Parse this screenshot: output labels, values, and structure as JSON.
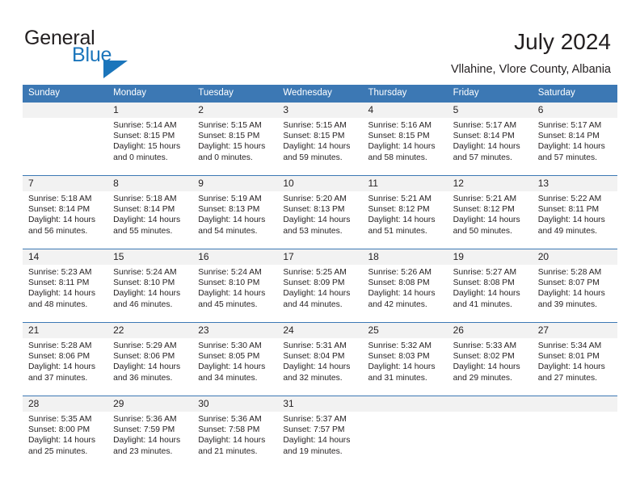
{
  "brand": {
    "name_part1": "General",
    "name_part2": "Blue",
    "accent_color": "#1b75bb"
  },
  "header": {
    "title": "July 2024",
    "subtitle": "Vllahine, Vlore County, Albania",
    "header_color": "#3c78b4",
    "daynum_row_color": "#f2f2f2"
  },
  "weekdays": [
    "Sunday",
    "Monday",
    "Tuesday",
    "Wednesday",
    "Thursday",
    "Friday",
    "Saturday"
  ],
  "labels": {
    "sunrise_prefix": "Sunrise:",
    "sunset_prefix": "Sunset:",
    "daylight_prefix": "Daylight:"
  },
  "weeks": [
    [
      {
        "day": "",
        "sunrise": "",
        "sunset": "",
        "daylight_l1": "",
        "daylight_l2": "",
        "empty": true
      },
      {
        "day": "1",
        "sunrise": "Sunrise: 5:14 AM",
        "sunset": "Sunset: 8:15 PM",
        "daylight_l1": "Daylight: 15 hours",
        "daylight_l2": "and 0 minutes.",
        "empty": false
      },
      {
        "day": "2",
        "sunrise": "Sunrise: 5:15 AM",
        "sunset": "Sunset: 8:15 PM",
        "daylight_l1": "Daylight: 15 hours",
        "daylight_l2": "and 0 minutes.",
        "empty": false
      },
      {
        "day": "3",
        "sunrise": "Sunrise: 5:15 AM",
        "sunset": "Sunset: 8:15 PM",
        "daylight_l1": "Daylight: 14 hours",
        "daylight_l2": "and 59 minutes.",
        "empty": false
      },
      {
        "day": "4",
        "sunrise": "Sunrise: 5:16 AM",
        "sunset": "Sunset: 8:15 PM",
        "daylight_l1": "Daylight: 14 hours",
        "daylight_l2": "and 58 minutes.",
        "empty": false
      },
      {
        "day": "5",
        "sunrise": "Sunrise: 5:17 AM",
        "sunset": "Sunset: 8:14 PM",
        "daylight_l1": "Daylight: 14 hours",
        "daylight_l2": "and 57 minutes.",
        "empty": false
      },
      {
        "day": "6",
        "sunrise": "Sunrise: 5:17 AM",
        "sunset": "Sunset: 8:14 PM",
        "daylight_l1": "Daylight: 14 hours",
        "daylight_l2": "and 57 minutes.",
        "empty": false
      }
    ],
    [
      {
        "day": "7",
        "sunrise": "Sunrise: 5:18 AM",
        "sunset": "Sunset: 8:14 PM",
        "daylight_l1": "Daylight: 14 hours",
        "daylight_l2": "and 56 minutes.",
        "empty": false
      },
      {
        "day": "8",
        "sunrise": "Sunrise: 5:18 AM",
        "sunset": "Sunset: 8:14 PM",
        "daylight_l1": "Daylight: 14 hours",
        "daylight_l2": "and 55 minutes.",
        "empty": false
      },
      {
        "day": "9",
        "sunrise": "Sunrise: 5:19 AM",
        "sunset": "Sunset: 8:13 PM",
        "daylight_l1": "Daylight: 14 hours",
        "daylight_l2": "and 54 minutes.",
        "empty": false
      },
      {
        "day": "10",
        "sunrise": "Sunrise: 5:20 AM",
        "sunset": "Sunset: 8:13 PM",
        "daylight_l1": "Daylight: 14 hours",
        "daylight_l2": "and 53 minutes.",
        "empty": false
      },
      {
        "day": "11",
        "sunrise": "Sunrise: 5:21 AM",
        "sunset": "Sunset: 8:12 PM",
        "daylight_l1": "Daylight: 14 hours",
        "daylight_l2": "and 51 minutes.",
        "empty": false
      },
      {
        "day": "12",
        "sunrise": "Sunrise: 5:21 AM",
        "sunset": "Sunset: 8:12 PM",
        "daylight_l1": "Daylight: 14 hours",
        "daylight_l2": "and 50 minutes.",
        "empty": false
      },
      {
        "day": "13",
        "sunrise": "Sunrise: 5:22 AM",
        "sunset": "Sunset: 8:11 PM",
        "daylight_l1": "Daylight: 14 hours",
        "daylight_l2": "and 49 minutes.",
        "empty": false
      }
    ],
    [
      {
        "day": "14",
        "sunrise": "Sunrise: 5:23 AM",
        "sunset": "Sunset: 8:11 PM",
        "daylight_l1": "Daylight: 14 hours",
        "daylight_l2": "and 48 minutes.",
        "empty": false
      },
      {
        "day": "15",
        "sunrise": "Sunrise: 5:24 AM",
        "sunset": "Sunset: 8:10 PM",
        "daylight_l1": "Daylight: 14 hours",
        "daylight_l2": "and 46 minutes.",
        "empty": false
      },
      {
        "day": "16",
        "sunrise": "Sunrise: 5:24 AM",
        "sunset": "Sunset: 8:10 PM",
        "daylight_l1": "Daylight: 14 hours",
        "daylight_l2": "and 45 minutes.",
        "empty": false
      },
      {
        "day": "17",
        "sunrise": "Sunrise: 5:25 AM",
        "sunset": "Sunset: 8:09 PM",
        "daylight_l1": "Daylight: 14 hours",
        "daylight_l2": "and 44 minutes.",
        "empty": false
      },
      {
        "day": "18",
        "sunrise": "Sunrise: 5:26 AM",
        "sunset": "Sunset: 8:08 PM",
        "daylight_l1": "Daylight: 14 hours",
        "daylight_l2": "and 42 minutes.",
        "empty": false
      },
      {
        "day": "19",
        "sunrise": "Sunrise: 5:27 AM",
        "sunset": "Sunset: 8:08 PM",
        "daylight_l1": "Daylight: 14 hours",
        "daylight_l2": "and 41 minutes.",
        "empty": false
      },
      {
        "day": "20",
        "sunrise": "Sunrise: 5:28 AM",
        "sunset": "Sunset: 8:07 PM",
        "daylight_l1": "Daylight: 14 hours",
        "daylight_l2": "and 39 minutes.",
        "empty": false
      }
    ],
    [
      {
        "day": "21",
        "sunrise": "Sunrise: 5:28 AM",
        "sunset": "Sunset: 8:06 PM",
        "daylight_l1": "Daylight: 14 hours",
        "daylight_l2": "and 37 minutes.",
        "empty": false
      },
      {
        "day": "22",
        "sunrise": "Sunrise: 5:29 AM",
        "sunset": "Sunset: 8:06 PM",
        "daylight_l1": "Daylight: 14 hours",
        "daylight_l2": "and 36 minutes.",
        "empty": false
      },
      {
        "day": "23",
        "sunrise": "Sunrise: 5:30 AM",
        "sunset": "Sunset: 8:05 PM",
        "daylight_l1": "Daylight: 14 hours",
        "daylight_l2": "and 34 minutes.",
        "empty": false
      },
      {
        "day": "24",
        "sunrise": "Sunrise: 5:31 AM",
        "sunset": "Sunset: 8:04 PM",
        "daylight_l1": "Daylight: 14 hours",
        "daylight_l2": "and 32 minutes.",
        "empty": false
      },
      {
        "day": "25",
        "sunrise": "Sunrise: 5:32 AM",
        "sunset": "Sunset: 8:03 PM",
        "daylight_l1": "Daylight: 14 hours",
        "daylight_l2": "and 31 minutes.",
        "empty": false
      },
      {
        "day": "26",
        "sunrise": "Sunrise: 5:33 AM",
        "sunset": "Sunset: 8:02 PM",
        "daylight_l1": "Daylight: 14 hours",
        "daylight_l2": "and 29 minutes.",
        "empty": false
      },
      {
        "day": "27",
        "sunrise": "Sunrise: 5:34 AM",
        "sunset": "Sunset: 8:01 PM",
        "daylight_l1": "Daylight: 14 hours",
        "daylight_l2": "and 27 minutes.",
        "empty": false
      }
    ],
    [
      {
        "day": "28",
        "sunrise": "Sunrise: 5:35 AM",
        "sunset": "Sunset: 8:00 PM",
        "daylight_l1": "Daylight: 14 hours",
        "daylight_l2": "and 25 minutes.",
        "empty": false
      },
      {
        "day": "29",
        "sunrise": "Sunrise: 5:36 AM",
        "sunset": "Sunset: 7:59 PM",
        "daylight_l1": "Daylight: 14 hours",
        "daylight_l2": "and 23 minutes.",
        "empty": false
      },
      {
        "day": "30",
        "sunrise": "Sunrise: 5:36 AM",
        "sunset": "Sunset: 7:58 PM",
        "daylight_l1": "Daylight: 14 hours",
        "daylight_l2": "and 21 minutes.",
        "empty": false
      },
      {
        "day": "31",
        "sunrise": "Sunrise: 5:37 AM",
        "sunset": "Sunset: 7:57 PM",
        "daylight_l1": "Daylight: 14 hours",
        "daylight_l2": "and 19 minutes.",
        "empty": false
      },
      {
        "day": "",
        "sunrise": "",
        "sunset": "",
        "daylight_l1": "",
        "daylight_l2": "",
        "empty": true
      },
      {
        "day": "",
        "sunrise": "",
        "sunset": "",
        "daylight_l1": "",
        "daylight_l2": "",
        "empty": true
      },
      {
        "day": "",
        "sunrise": "",
        "sunset": "",
        "daylight_l1": "",
        "daylight_l2": "",
        "empty": true
      }
    ]
  ]
}
